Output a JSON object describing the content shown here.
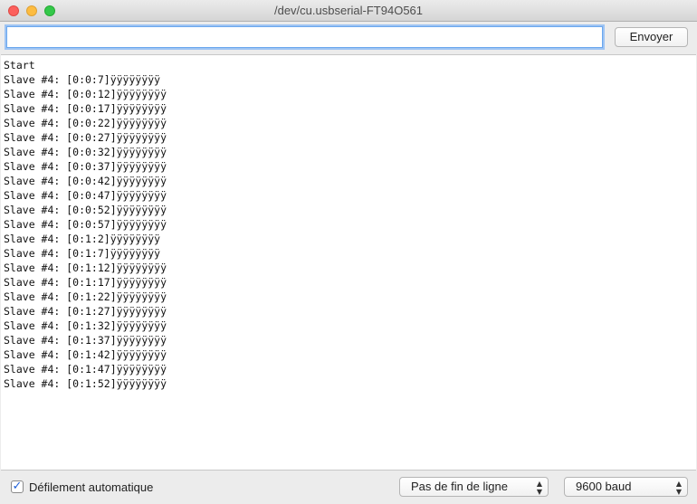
{
  "window": {
    "title": "/dev/cu.usbserial-FT94O561"
  },
  "toolbar": {
    "input_value": "",
    "send_label": "Envoyer"
  },
  "output": {
    "lines": [
      "Start",
      "Slave #4: [0:0:7]ÿÿÿÿÿÿÿÿ",
      "Slave #4: [0:0:12]ÿÿÿÿÿÿÿÿ",
      "Slave #4: [0:0:17]ÿÿÿÿÿÿÿÿ",
      "Slave #4: [0:0:22]ÿÿÿÿÿÿÿÿ",
      "Slave #4: [0:0:27]ÿÿÿÿÿÿÿÿ",
      "Slave #4: [0:0:32]ÿÿÿÿÿÿÿÿ",
      "Slave #4: [0:0:37]ÿÿÿÿÿÿÿÿ",
      "Slave #4: [0:0:42]ÿÿÿÿÿÿÿÿ",
      "Slave #4: [0:0:47]ÿÿÿÿÿÿÿÿ",
      "Slave #4: [0:0:52]ÿÿÿÿÿÿÿÿ",
      "Slave #4: [0:0:57]ÿÿÿÿÿÿÿÿ",
      "Slave #4: [0:1:2]ÿÿÿÿÿÿÿÿ",
      "Slave #4: [0:1:7]ÿÿÿÿÿÿÿÿ",
      "Slave #4: [0:1:12]ÿÿÿÿÿÿÿÿ",
      "Slave #4: [0:1:17]ÿÿÿÿÿÿÿÿ",
      "Slave #4: [0:1:22]ÿÿÿÿÿÿÿÿ",
      "Slave #4: [0:1:27]ÿÿÿÿÿÿÿÿ",
      "Slave #4: [0:1:32]ÿÿÿÿÿÿÿÿ",
      "Slave #4: [0:1:37]ÿÿÿÿÿÿÿÿ",
      "Slave #4: [0:1:42]ÿÿÿÿÿÿÿÿ",
      "Slave #4: [0:1:47]ÿÿÿÿÿÿÿÿ",
      "Slave #4: [0:1:52]ÿÿÿÿÿÿÿÿ"
    ]
  },
  "bottombar": {
    "autoscroll_label": "Défilement automatique",
    "autoscroll_checked": true,
    "line_ending_value": "Pas de fin de ligne",
    "baud_value": "9600 baud"
  },
  "icons": {
    "close": "close-button-icon",
    "minimize": "minimize-button-icon",
    "maximize": "zoom-button-icon",
    "checkmark": "checkmark-icon",
    "select_arrows": "chevron-up-down-icon"
  },
  "colors": {
    "close": "#fc605c",
    "minimize": "#fdbc40",
    "maximize": "#34c84a",
    "focus_ring": "#6aa7ee"
  }
}
